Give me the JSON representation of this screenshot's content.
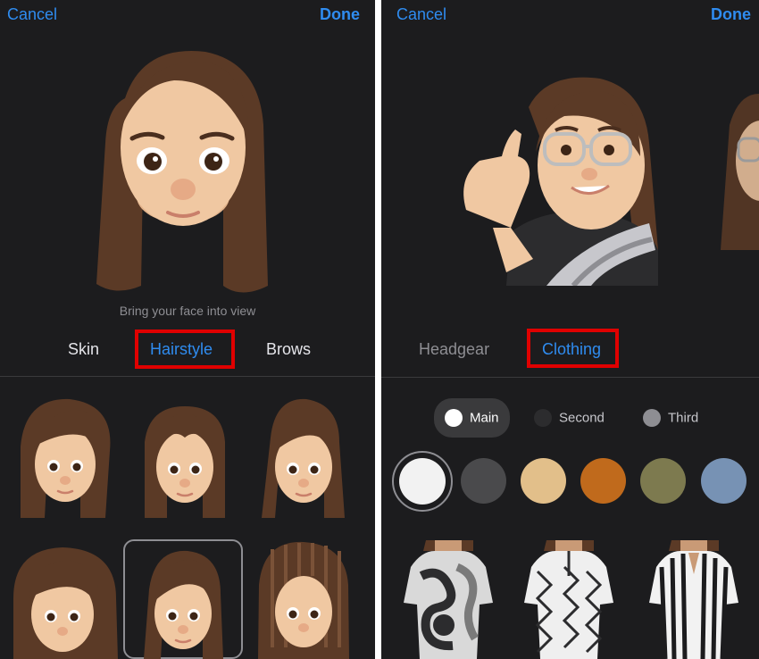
{
  "left": {
    "nav": {
      "cancel": "Cancel",
      "done": "Done"
    },
    "hint": "Bring your face into view",
    "tabs": [
      {
        "label": "Skin",
        "active": false
      },
      {
        "label": "Hairstyle",
        "active": true
      },
      {
        "label": "Brows",
        "active": false
      }
    ],
    "hairstyle_options": [
      "long-side-swept",
      "straight-center-part",
      "tied-back",
      "voluminous-waves",
      "long-straight-selected",
      "dreadlocks"
    ],
    "selected_hairstyle": "long-straight-selected"
  },
  "right": {
    "nav": {
      "cancel": "Cancel",
      "done": "Done"
    },
    "tabs": [
      {
        "label": "Headgear",
        "active": false
      },
      {
        "label": "Clothing",
        "active": true
      }
    ],
    "color_targets": [
      {
        "label": "Main",
        "selected": true,
        "dot_color": "#ffffff"
      },
      {
        "label": "Second",
        "selected": false,
        "dot_color": "#2c2c2e"
      },
      {
        "label": "Third",
        "selected": false,
        "dot_color": "#8e8e93"
      }
    ],
    "swatches": [
      "#f2f2f2",
      "#4a4a4c",
      "#e2bf8a",
      "#c06a1c",
      "#7d7a4f",
      "#7792b4"
    ],
    "selected_swatch": "#f2f2f2",
    "clothing_options": [
      "swirl-print-top",
      "geometric-print-top",
      "striped-top"
    ]
  },
  "colors": {
    "accent": "#2f8cf0",
    "background": "#1c1c1e",
    "annotation_red": "#e00000",
    "skin": "#f0c8a2",
    "hair": "#5b3a26"
  }
}
